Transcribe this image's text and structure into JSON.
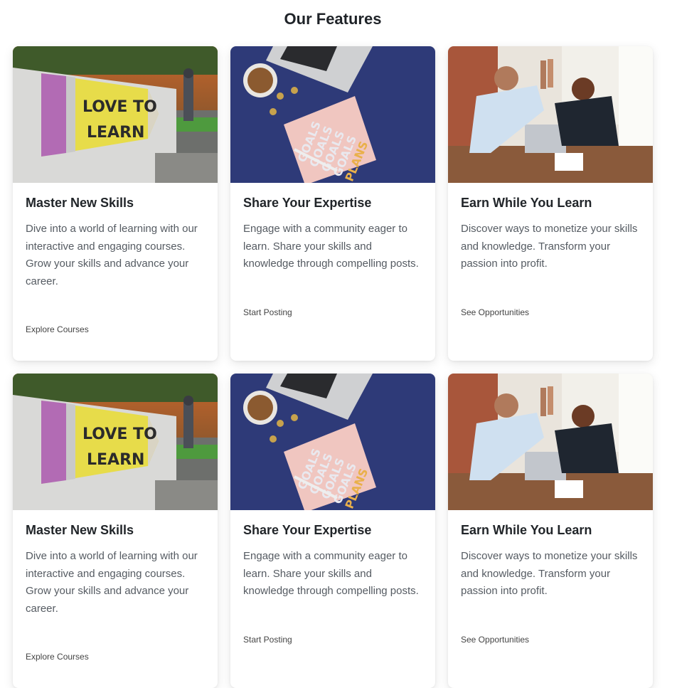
{
  "section_title": "Our Features",
  "rows": [
    {
      "cards": [
        {
          "image": "love-to-learn-pencil-sign",
          "image_text": [
            "LOVE TO",
            "LEARN"
          ],
          "title": "Master New Skills",
          "text": "Dive into a world of learning with our interactive and engaging courses. Grow your skills and advance your career.",
          "cta": "Explore Courses"
        },
        {
          "image": "desk-goals-notebook",
          "image_text": [
            "GOALS",
            "GOALS",
            "GOALS",
            "GOALS",
            "PLANS"
          ],
          "title": "Share Your Expertise",
          "text": "Engage with a community eager to learn. Share your skills and knowledge through compelling posts.",
          "cta": "Start Posting"
        },
        {
          "image": "office-high-five",
          "title": "Earn While You Learn",
          "text": "Discover ways to monetize your skills and knowledge. Transform your passion into profit.",
          "cta": "See Opportunities"
        }
      ]
    },
    {
      "cards": [
        {
          "image": "love-to-learn-pencil-sign",
          "image_text": [
            "LOVE TO",
            "LEARN"
          ],
          "title": "Master New Skills",
          "text": "Dive into a world of learning with our interactive and engaging courses. Grow your skills and advance your career.",
          "cta": "Explore Courses"
        },
        {
          "image": "desk-goals-notebook",
          "image_text": [
            "GOALS",
            "GOALS",
            "GOALS",
            "GOALS",
            "PLANS"
          ],
          "title": "Share Your Expertise",
          "text": "Engage with a community eager to learn. Share your skills and knowledge through compelling posts.",
          "cta": "Start Posting"
        },
        {
          "image": "office-high-five",
          "title": "Earn While You Learn",
          "text": "Discover ways to monetize your skills and knowledge. Transform your passion into profit.",
          "cta": "See Opportunities"
        }
      ]
    }
  ]
}
